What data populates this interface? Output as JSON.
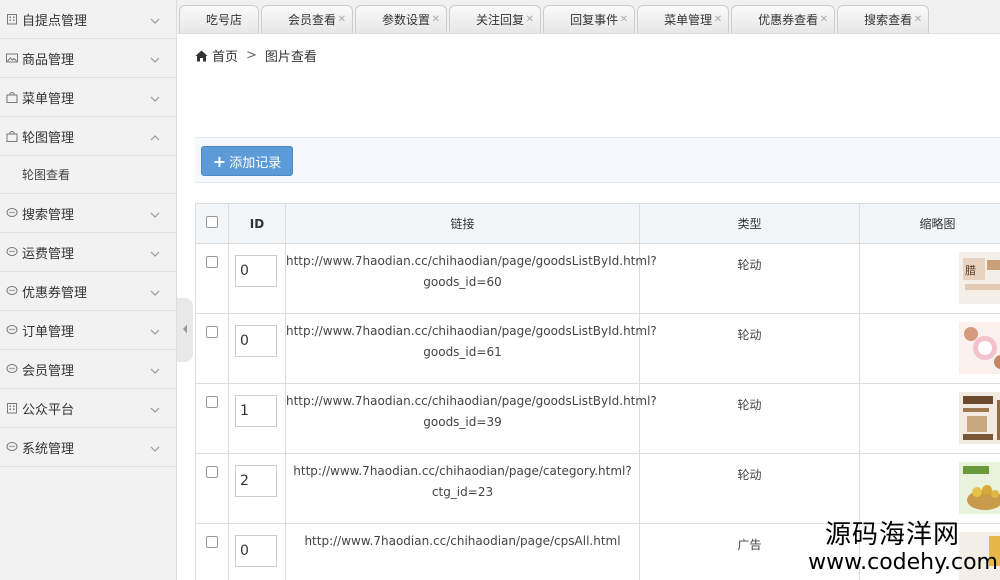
{
  "sidebar": {
    "items": [
      {
        "label": "自提点管理",
        "icon": "building-icon",
        "expanded": false
      },
      {
        "label": "商品管理",
        "icon": "image-icon",
        "expanded": false
      },
      {
        "label": "菜单管理",
        "icon": "bag-icon",
        "expanded": false
      },
      {
        "label": "轮图管理",
        "icon": "bag-icon",
        "expanded": true
      },
      {
        "label": "搜索管理",
        "icon": "chat-icon",
        "expanded": false
      },
      {
        "label": "运费管理",
        "icon": "chat-icon",
        "expanded": false
      },
      {
        "label": "优惠券管理",
        "icon": "chat-icon",
        "expanded": false
      },
      {
        "label": "订单管理",
        "icon": "chat-icon",
        "expanded": false
      },
      {
        "label": "会员管理",
        "icon": "chat-icon",
        "expanded": false
      },
      {
        "label": "公众平台",
        "icon": "building-icon",
        "expanded": false
      },
      {
        "label": "系统管理",
        "icon": "chat-icon",
        "expanded": false
      }
    ],
    "sub_items": {
      "carousel": [
        {
          "label": "轮图查看"
        }
      ]
    }
  },
  "tabs": [
    {
      "label": "吃号店"
    },
    {
      "label": "会员查看"
    },
    {
      "label": "参数设置"
    },
    {
      "label": "关注回复"
    },
    {
      "label": "回复事件"
    },
    {
      "label": "菜单管理"
    },
    {
      "label": "优惠券查看"
    },
    {
      "label": "搜索查看"
    }
  ],
  "breadcrumb": {
    "home": "首页",
    "separator": ">",
    "current": "图片查看"
  },
  "toolbar": {
    "add_label": "添加记录"
  },
  "table": {
    "columns": [
      "ID",
      "链接",
      "类型",
      "缩略图"
    ],
    "rows": [
      {
        "id": "0",
        "link_line1": "http://www.7haodian.cc/chihaodian/page/goodsListById.html?",
        "link_line2": "goods_id=60",
        "type": "轮动",
        "thumb": "thumb-1"
      },
      {
        "id": "0",
        "link_line1": "http://www.7haodian.cc/chihaodian/page/goodsListById.html?",
        "link_line2": "goods_id=61",
        "type": "轮动",
        "thumb": "thumb-2"
      },
      {
        "id": "1",
        "link_line1": "http://www.7haodian.cc/chihaodian/page/goodsListById.html?",
        "link_line2": "goods_id=39",
        "type": "轮动",
        "thumb": "thumb-3"
      },
      {
        "id": "2",
        "link_line1": "http://www.7haodian.cc/chihaodian/page/category.html?",
        "link_line2": "ctg_id=23",
        "type": "轮动",
        "thumb": "thumb-4"
      },
      {
        "id": "0",
        "link_line1": "http://www.7haodian.cc/chihaodian/page/cpsAll.html",
        "link_line2": "",
        "type": "广告",
        "thumb": "thumb-5"
      }
    ]
  },
  "watermark": {
    "line1": "源码海洋网",
    "line2": "www.codehy.com"
  },
  "colors": {
    "accent": "#5d9ad8",
    "sidebar_bg": "#f2f2f2",
    "toolbar_bg": "#f5f8fc"
  }
}
